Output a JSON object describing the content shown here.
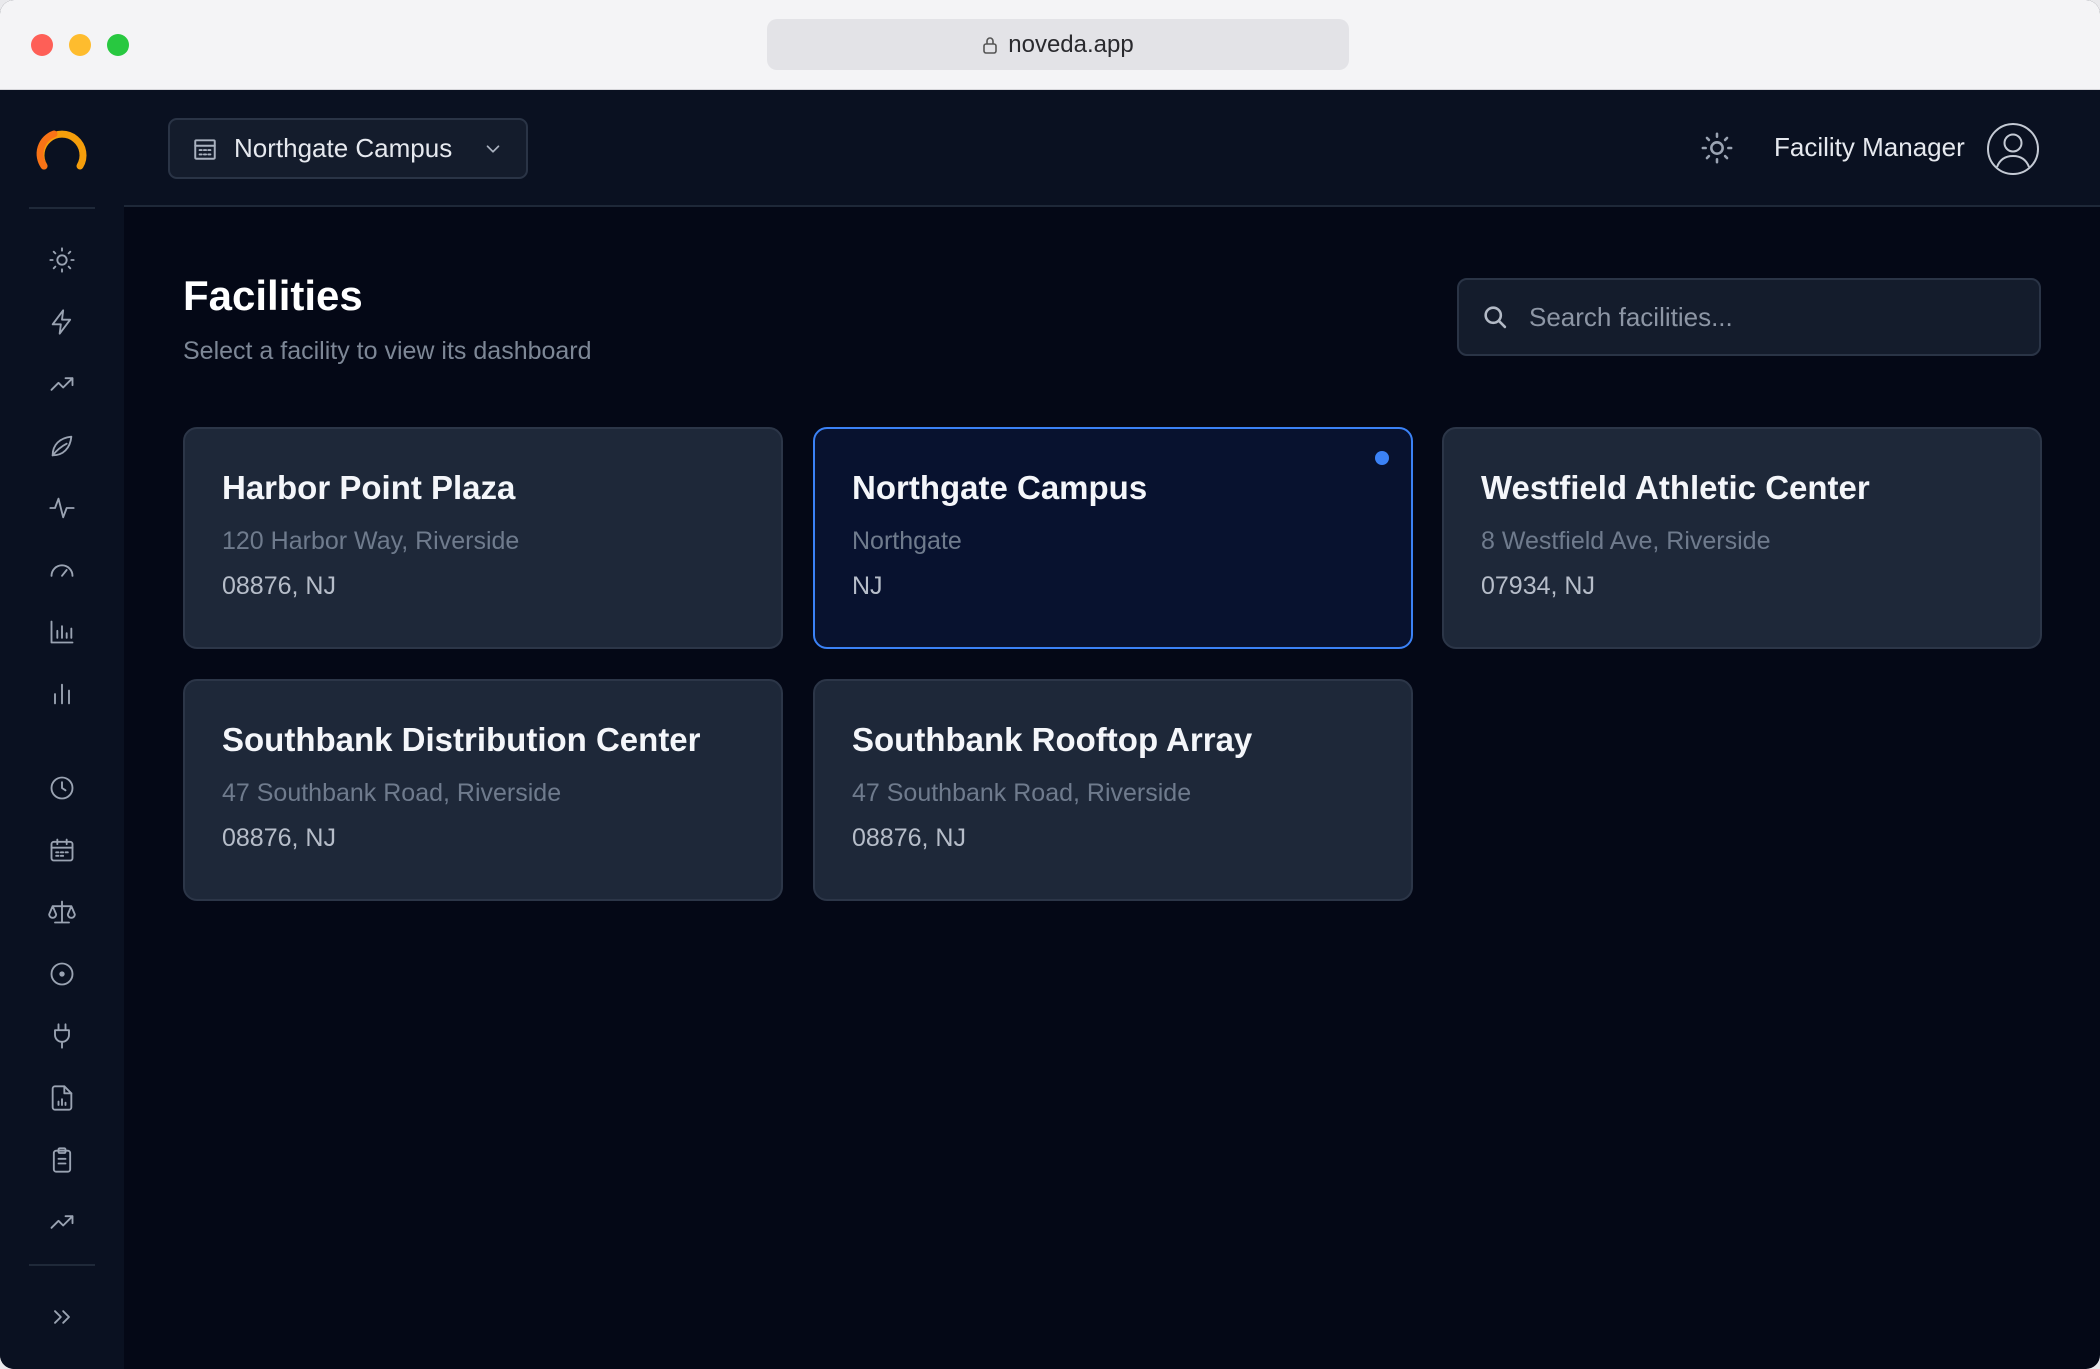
{
  "browser": {
    "url": "noveda.app"
  },
  "header": {
    "campus_selector": "Northgate Campus",
    "user_name": "Facility Manager"
  },
  "page": {
    "title": "Facilities",
    "subtitle": "Select a facility to view its dashboard",
    "search_placeholder": "Search facilities..."
  },
  "facilities": [
    {
      "name": "Harbor Point Plaza",
      "line1": "120 Harbor Way, Riverside",
      "line2": "08876, NJ",
      "selected": false
    },
    {
      "name": "Northgate Campus",
      "line1": "Northgate",
      "line2": "NJ",
      "selected": true
    },
    {
      "name": "Westfield Athletic Center",
      "line1": "8 Westfield Ave, Riverside",
      "line2": "07934, NJ",
      "selected": false
    },
    {
      "name": "Southbank Distribution Center",
      "line1": "47 Southbank Road, Riverside",
      "line2": "08876, NJ",
      "selected": false
    },
    {
      "name": "Southbank Rooftop Array",
      "line1": "47 Southbank Road, Riverside",
      "line2": "08876, NJ",
      "selected": false
    }
  ],
  "sidebar": {
    "icons": [
      "sun-icon",
      "lightning-icon",
      "trending-up-icon",
      "leaf-icon",
      "activity-icon",
      "gauge-icon",
      "bar-chart-icon",
      "bar-chart-simple-icon",
      "clock-icon",
      "calendar-icon",
      "scale-icon",
      "target-icon",
      "plug-icon",
      "file-chart-icon",
      "clipboard-icon",
      "trending-up-icon",
      "chevrons-right-icon"
    ]
  },
  "colors": {
    "accent": "#3b82f6",
    "logo": "#f59e0b",
    "background": "#040816"
  }
}
